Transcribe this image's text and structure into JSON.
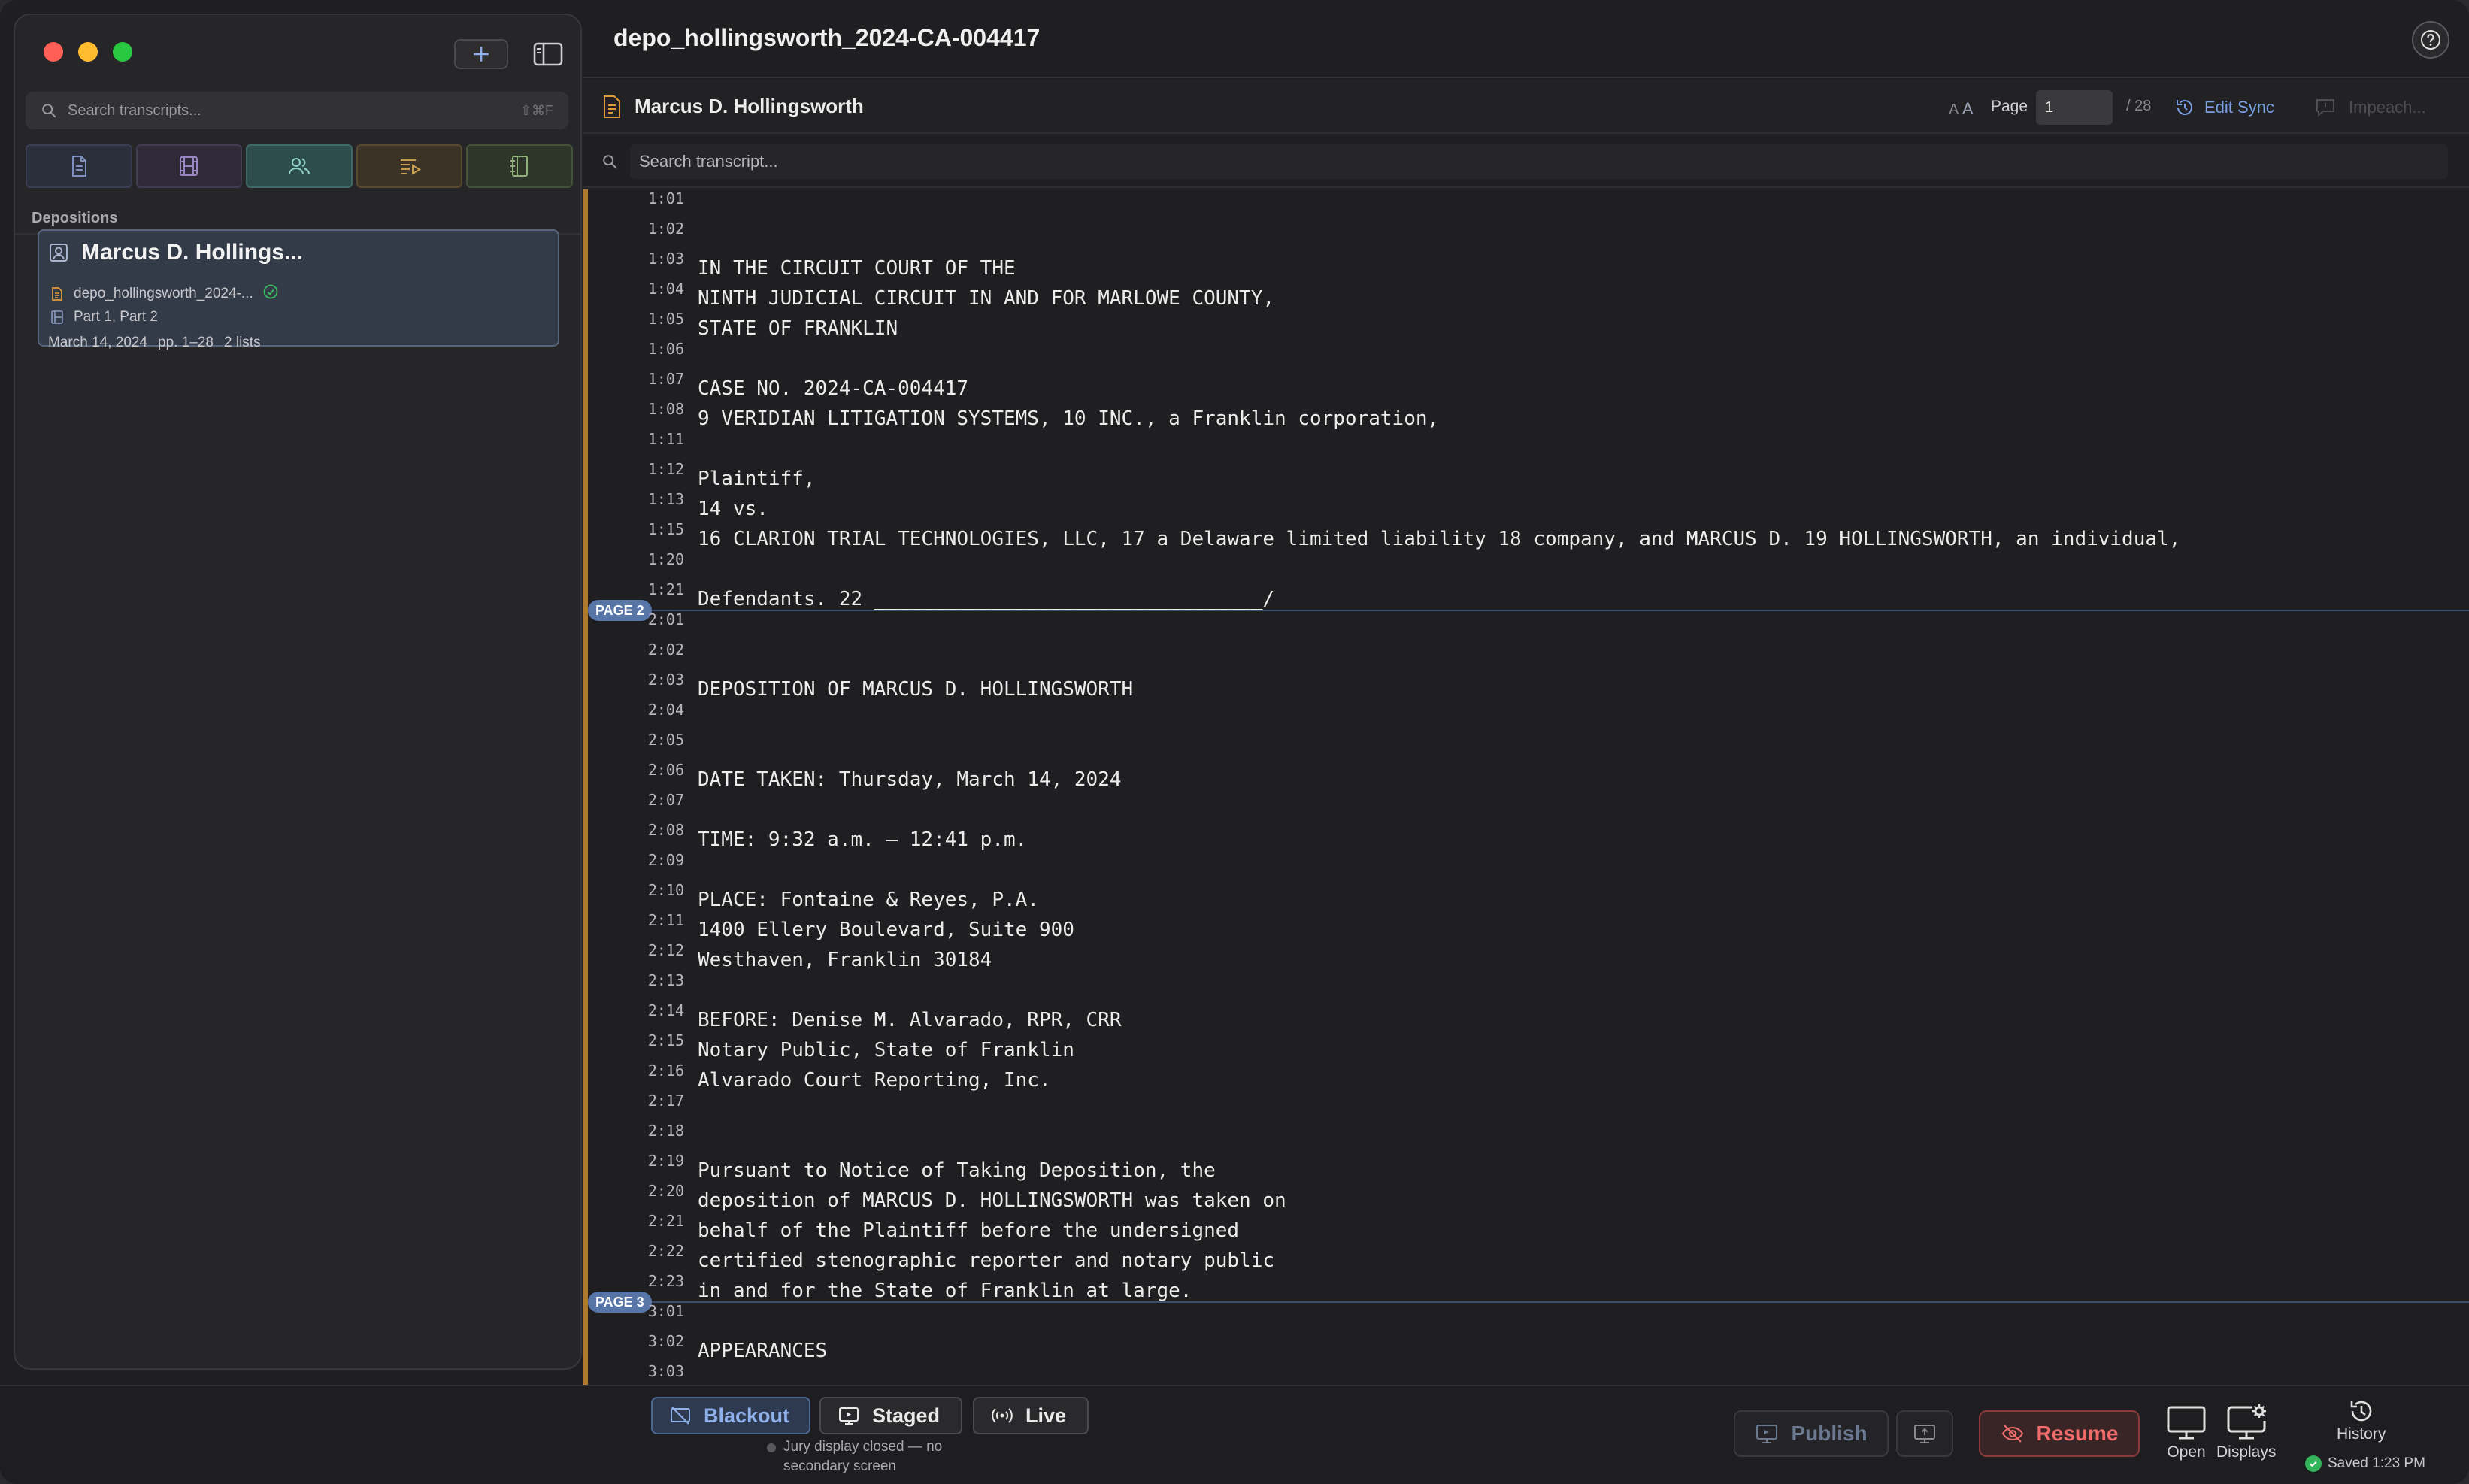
{
  "window": {
    "title": "depo_hollingsworth_2024-CA-004417"
  },
  "sidebar": {
    "search_placeholder": "Search transcripts...",
    "search_shortcut": "⇧⌘F",
    "filter_tabs": [
      {
        "id": "docs",
        "icon": "document-icon"
      },
      {
        "id": "video",
        "icon": "film-icon"
      },
      {
        "id": "people",
        "icon": "people-icon",
        "active": true
      },
      {
        "id": "clips",
        "icon": "playlist-icon"
      },
      {
        "id": "exhibits",
        "icon": "binder-icon"
      }
    ],
    "section_label": "Depositions",
    "card": {
      "title": "Marcus D. Hollings...",
      "file": "depo_hollingsworth_2024-...",
      "parts": "Part 1, Part 2",
      "date": "March 14, 2024",
      "pages": "pp. 1–28",
      "lists": "2 lists"
    }
  },
  "header": {
    "witness": "Marcus D. Hollingsworth",
    "font_small": "A",
    "font_large": "A",
    "page_label": "Page",
    "page_value": "1",
    "page_total": "/ 28",
    "edit_sync": "Edit Sync",
    "impeach": "Impeach..."
  },
  "transcript": {
    "search_placeholder": "Search transcript...",
    "page_badges": [
      "PAGE 2",
      "PAGE 3"
    ],
    "lines": [
      {
        "ln": "1:01",
        "text": ""
      },
      {
        "ln": "1:02",
        "text": ""
      },
      {
        "ln": "1:03",
        "text": "IN THE CIRCUIT COURT OF THE"
      },
      {
        "ln": "1:04",
        "text": "NINTH JUDICIAL CIRCUIT IN AND FOR MARLOWE COUNTY,"
      },
      {
        "ln": "1:05",
        "text": "STATE OF FRANKLIN"
      },
      {
        "ln": "1:06",
        "text": ""
      },
      {
        "ln": "1:07",
        "text": "CASE NO. 2024-CA-004417"
      },
      {
        "ln": "1:08",
        "text": "9 VERIDIAN LITIGATION SYSTEMS, 10 INC., a Franklin corporation,"
      },
      {
        "ln": "1:11",
        "text": ""
      },
      {
        "ln": "1:12",
        "text": "Plaintiff,"
      },
      {
        "ln": "1:13",
        "text": "14 vs."
      },
      {
        "ln": "1:15",
        "text": "16 CLARION TRIAL TECHNOLOGIES, LLC, 17 a Delaware limited liability 18 company, and MARCUS D. 19 HOLLINGSWORTH, an individual,"
      },
      {
        "ln": "1:20",
        "text": ""
      },
      {
        "ln": "1:21",
        "text": "Defendants. 22 _________________________________/"
      },
      {
        "ln": "2:01",
        "text": ""
      },
      {
        "ln": "2:02",
        "text": ""
      },
      {
        "ln": "2:03",
        "text": "DEPOSITION OF MARCUS D. HOLLINGSWORTH"
      },
      {
        "ln": "2:04",
        "text": ""
      },
      {
        "ln": "2:05",
        "text": ""
      },
      {
        "ln": "2:06",
        "text": "DATE TAKEN: Thursday, March 14, 2024"
      },
      {
        "ln": "2:07",
        "text": ""
      },
      {
        "ln": "2:08",
        "text": "TIME: 9:32 a.m. – 12:41 p.m."
      },
      {
        "ln": "2:09",
        "text": ""
      },
      {
        "ln": "2:10",
        "text": "PLACE: Fontaine & Reyes, P.A."
      },
      {
        "ln": "2:11",
        "text": "1400 Ellery Boulevard, Suite 900"
      },
      {
        "ln": "2:12",
        "text": "Westhaven, Franklin 30184"
      },
      {
        "ln": "2:13",
        "text": ""
      },
      {
        "ln": "2:14",
        "text": "BEFORE: Denise M. Alvarado, RPR, CRR"
      },
      {
        "ln": "2:15",
        "text": "Notary Public, State of Franklin"
      },
      {
        "ln": "2:16",
        "text": "Alvarado Court Reporting, Inc."
      },
      {
        "ln": "2:17",
        "text": ""
      },
      {
        "ln": "2:18",
        "text": ""
      },
      {
        "ln": "2:19",
        "text": "Pursuant to Notice of Taking Deposition, the"
      },
      {
        "ln": "2:20",
        "text": "deposition of MARCUS D. HOLLINGSWORTH was taken on"
      },
      {
        "ln": "2:21",
        "text": "behalf of the Plaintiff before the undersigned"
      },
      {
        "ln": "2:22",
        "text": "certified stenographic reporter and notary public"
      },
      {
        "ln": "2:23",
        "text": "in and for the State of Franklin at large."
      },
      {
        "ln": "3:01",
        "text": ""
      },
      {
        "ln": "3:02",
        "text": "APPEARANCES"
      },
      {
        "ln": "3:03",
        "text": ""
      }
    ]
  },
  "bottom": {
    "blackout": "Blackout",
    "staged": "Staged",
    "live": "Live",
    "jury_status": "Jury display closed — no secondary screen",
    "publish": "Publish",
    "resume": "Resume",
    "open_label": "Open",
    "displays_label": "Displays",
    "history_label": "History",
    "saved": "Saved 1:23 PM"
  },
  "colors": {
    "accent_blue": "#7aa0e4",
    "resume_red": "#f06b6b",
    "page_badge": "#5875a8",
    "gutter_orange": "#b07a2e",
    "saved_green": "#31b45a"
  }
}
